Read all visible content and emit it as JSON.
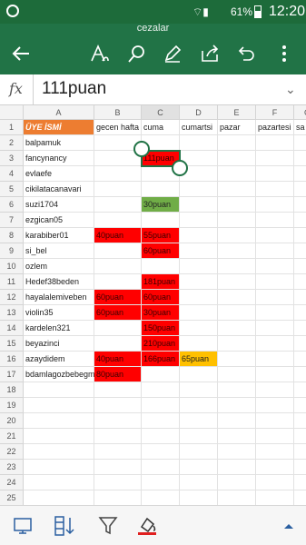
{
  "status": {
    "signal_label": "",
    "battery": "61%",
    "time": "12:20"
  },
  "toolbar": {
    "title": "cezalar"
  },
  "formula": {
    "fx": "fx",
    "value": "111puan"
  },
  "columns": [
    "A",
    "B",
    "C",
    "D",
    "E",
    "F",
    "G"
  ],
  "rows": [
    "1",
    "2",
    "3",
    "4",
    "5",
    "6",
    "7",
    "8",
    "9",
    "10",
    "11",
    "12",
    "13",
    "14",
    "15",
    "16",
    "17",
    "18",
    "19",
    "20",
    "21",
    "22",
    "23",
    "24",
    "25",
    "26"
  ],
  "header": {
    "a1": "ÜYE İSMİ",
    "b1": "gecen hafta",
    "c1": "cuma",
    "d1": "cumartsi",
    "e1": "pazar",
    "f1": "pazartesi",
    "g1": "sa"
  },
  "names": [
    "balpamuk",
    "fancynancy",
    "evlaefe",
    "cikilatacanavari",
    "suzi1704",
    "ezgican05",
    "karabiber01",
    "si_bel",
    "ozlem",
    "Hedef38beden",
    "hayalalemiveben",
    "violin35",
    "kardelen321",
    "beyazinci",
    "azaydidem",
    "bdamlagozbebegm"
  ],
  "cells": {
    "c3": "111puan",
    "c6": "30puan",
    "b8": "40puan",
    "c8": "55puan",
    "c9": "60puan",
    "c11": "181puan",
    "b12": "60puan",
    "c12": "60puan",
    "b13": "60puan",
    "c13": "30puan",
    "c14": "150puan",
    "c15": "210puan",
    "b16": "40puan",
    "c16": "166puan",
    "d16": "65puan",
    "b17": "80puan"
  },
  "colors": {
    "red": "#ff0000",
    "green": "#70ad47",
    "orange": "#ffc000",
    "header_orange": "#ed7d31",
    "excel_green": "#217346"
  }
}
